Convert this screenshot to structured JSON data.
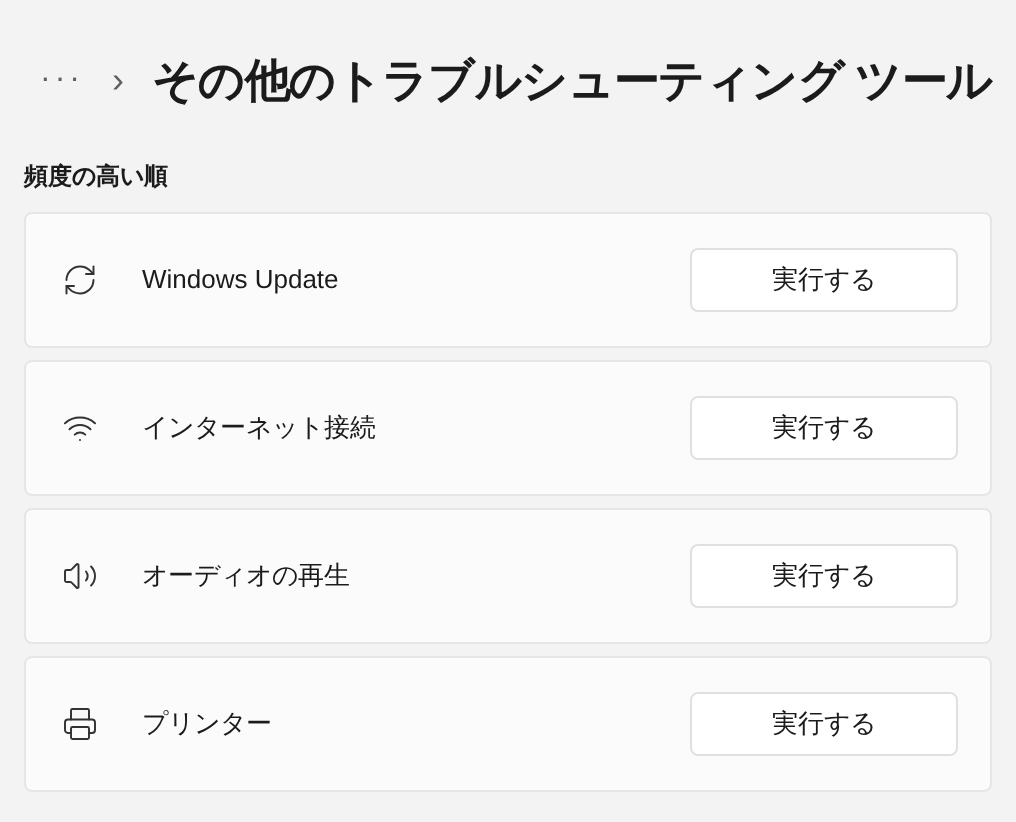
{
  "breadcrumb": {
    "more": "···",
    "separator": "›",
    "title": "その他のトラブルシューティング ツール"
  },
  "section": {
    "label": "頻度の高い順"
  },
  "items": [
    {
      "kind": "update",
      "name": "Windows Update",
      "button": "実行する"
    },
    {
      "kind": "network",
      "name": "インターネット接続",
      "button": "実行する"
    },
    {
      "kind": "audio",
      "name": "オーディオの再生",
      "button": "実行する"
    },
    {
      "kind": "printer",
      "name": "プリンター",
      "button": "実行する"
    }
  ]
}
